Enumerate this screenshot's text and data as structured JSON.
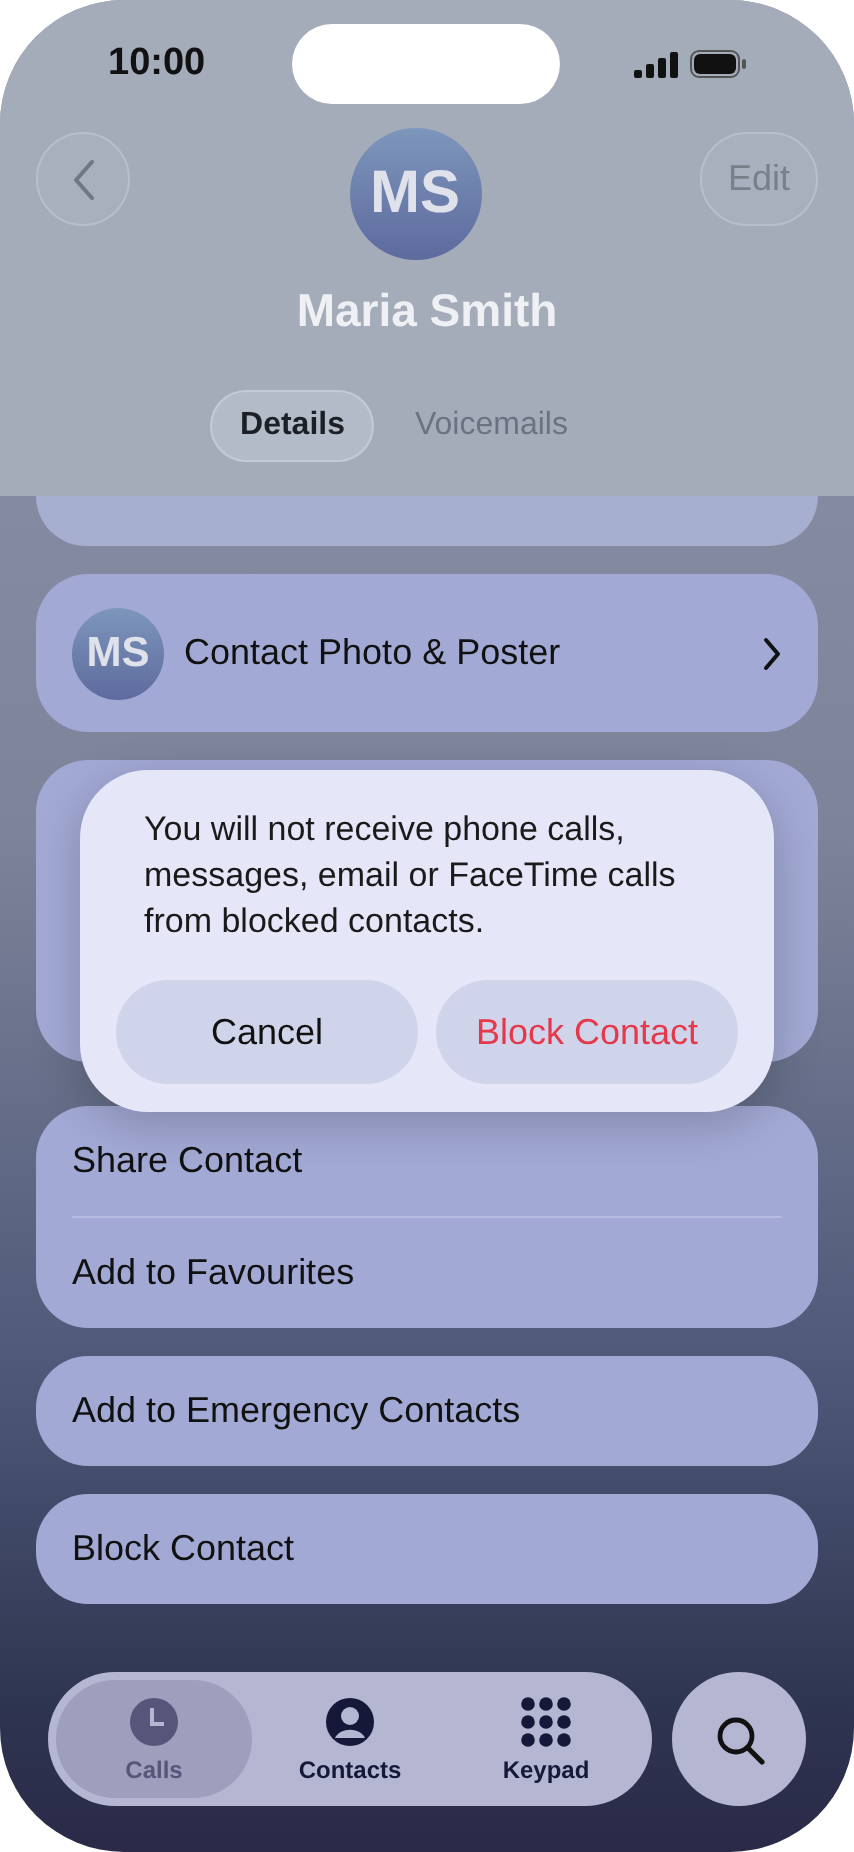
{
  "status_bar": {
    "time": "10:00"
  },
  "header": {
    "avatar_initials": "MS",
    "name": "Maria Smith",
    "edit_button": "Edit",
    "segments": [
      {
        "label": "Details",
        "selected": true
      },
      {
        "label": "Voicemails",
        "selected": false
      }
    ]
  },
  "photo_row": {
    "avatar_initials": "MS",
    "label": "Contact Photo & Poster"
  },
  "action_groups": [
    [
      "Share Contact",
      "Add to Favourites"
    ],
    [
      "Add to Emergency Contacts"
    ],
    [
      "Block Contact"
    ]
  ],
  "alert": {
    "message": "You will not receive phone calls, messages, email or FaceTime calls from blocked contacts.",
    "buttons": [
      {
        "label": "Cancel",
        "kind": "cancel"
      },
      {
        "label": "Block Contact",
        "kind": "destructive"
      }
    ]
  },
  "tab_bar": {
    "tabs": [
      {
        "label": "Calls",
        "selected": true
      },
      {
        "label": "Contacts",
        "selected": false
      },
      {
        "label": "Keypad",
        "selected": false
      }
    ]
  }
}
